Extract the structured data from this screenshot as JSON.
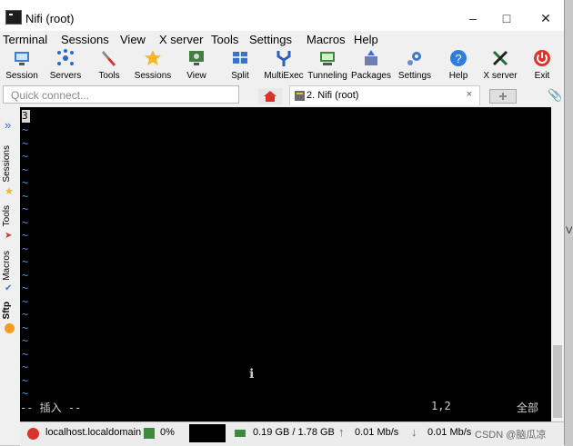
{
  "window": {
    "title": "Nifi (root)",
    "minimize_icon": "minimize-icon",
    "maximize_icon": "maximize-icon",
    "close_icon": "close-icon"
  },
  "menu": [
    "Terminal",
    "Sessions",
    "View",
    "X server",
    "Tools",
    "Settings",
    "Macros",
    "Help"
  ],
  "toolbar": [
    {
      "label": "Session",
      "icon": "session-icon",
      "color": "#3b7fd0"
    },
    {
      "label": "Servers",
      "icon": "servers-icon",
      "color": "#2a6bc4"
    },
    {
      "label": "Tools",
      "icon": "tools-icon",
      "color": "#d9342b"
    },
    {
      "label": "Sessions",
      "icon": "star-icon",
      "color": "#f3b81f"
    },
    {
      "label": "View",
      "icon": "view-icon",
      "color": "#3f7f3f"
    },
    {
      "label": "Split",
      "icon": "split-icon",
      "color": "#3a74c9"
    },
    {
      "label": "MultiExec",
      "icon": "multiexec-icon",
      "color": "#2f5fbf"
    },
    {
      "label": "Tunneling",
      "icon": "tunneling-icon",
      "color": "#3c8a3c"
    },
    {
      "label": "Packages",
      "icon": "packages-icon",
      "color": "#6c7fae"
    },
    {
      "label": "Settings",
      "icon": "gear-icon",
      "color": "#3b78c9"
    },
    {
      "label": "Help",
      "icon": "help-icon",
      "color": "#2e7de0"
    },
    {
      "label": "X server",
      "icon": "xserver-icon",
      "color": "#1e6f3a"
    },
    {
      "label": "Exit",
      "icon": "power-icon",
      "color": "#e0322b"
    }
  ],
  "quick_connect": {
    "placeholder": "Quick connect..."
  },
  "tabs": {
    "session_tab": "2. Nifi (root)",
    "close": "×"
  },
  "sidebar": {
    "sessions": "Sessions",
    "tools": "Tools",
    "macros": "Macros",
    "sftp": "Sftp"
  },
  "terminal": {
    "cursor_char": "3",
    "tilde": "~",
    "mode": "-- 插入 --",
    "position": "1,2",
    "scope": "全部"
  },
  "status": {
    "host": "localhost.localdomain",
    "cpu": "0%",
    "memory": "0.19 GB / 1.78 GB",
    "upload": "0.01 Mb/s",
    "download": "0.01 Mb/s",
    "watermark": "CSDN @脑瓜凉"
  },
  "outside_char": "V"
}
